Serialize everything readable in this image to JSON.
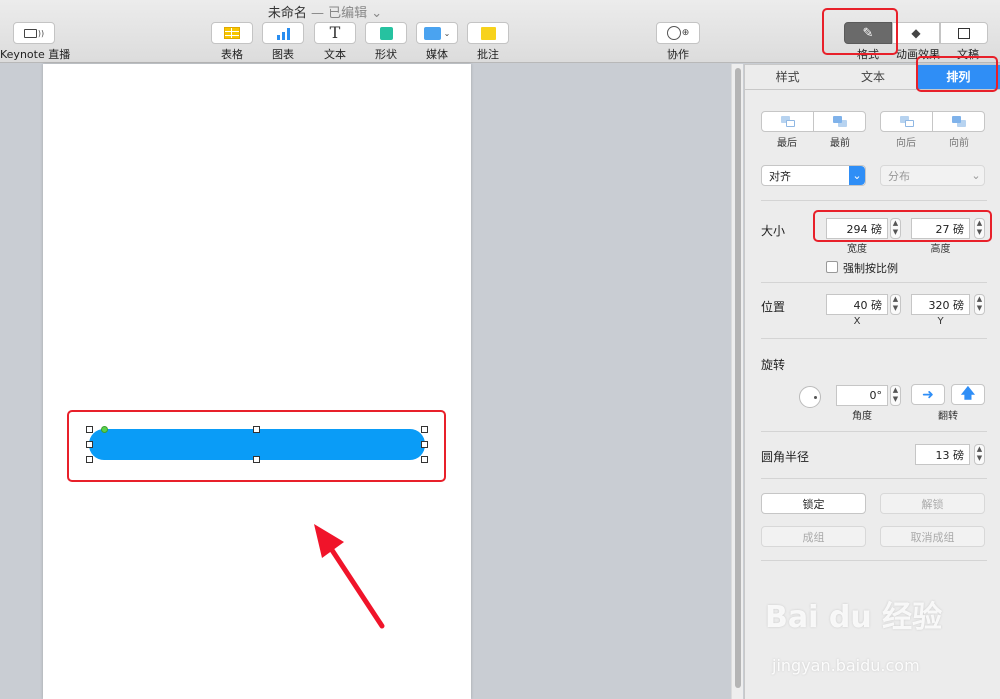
{
  "app": {
    "document_title": "未命名",
    "edited_status": "— 已编辑 ⌄"
  },
  "toolbar": {
    "keynote_live": "Keynote 直播",
    "table": "表格",
    "chart": "图表",
    "text": "文本",
    "shape": "形状",
    "media": "媒体",
    "comment": "批注",
    "collaborate": "协作",
    "format": "格式",
    "animate": "动画效果",
    "document": "文稿"
  },
  "inspector": {
    "tabs": [
      "样式",
      "文本",
      "排列"
    ],
    "active_tab": "排列",
    "layer_buttons": {
      "back": "最后",
      "front": "最前",
      "backward": "向后",
      "forward": "向前"
    },
    "align_select": "对齐",
    "distribute_select": "分布",
    "size": {
      "label": "大小",
      "width_value": "294 磅",
      "width_label": "宽度",
      "height_value": "27 磅",
      "height_label": "高度",
      "constrain_label": "强制按比例",
      "constrain_checked": false
    },
    "position": {
      "label": "位置",
      "x_value": "40 磅",
      "x_label": "X",
      "y_value": "320 磅",
      "y_label": "Y"
    },
    "rotate": {
      "label": "旋转",
      "angle_value": "0°",
      "angle_label": "角度",
      "flip_label": "翻转"
    },
    "corner_radius": {
      "label": "圆角半径",
      "value": "13 磅"
    },
    "lock": "锁定",
    "unlock": "解锁",
    "group": "成组",
    "ungroup": "取消成组"
  },
  "watermark": {
    "brand": "Bai du 经验",
    "url": "jingyan.baidu.com"
  },
  "colors": {
    "shape_fill": "#0a9cf7",
    "accent": "#2f8ef6",
    "annotation": "#e8202a"
  }
}
